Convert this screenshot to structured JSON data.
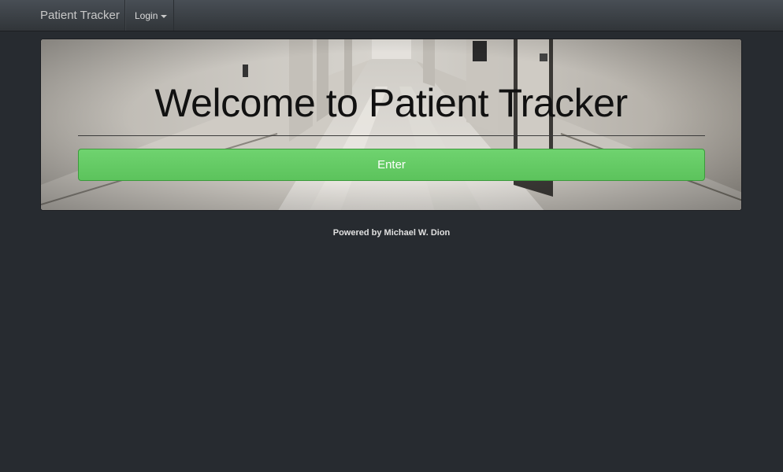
{
  "navbar": {
    "brand": "Patient Tracker",
    "login_label": "Login"
  },
  "hero": {
    "title": "Welcome to Patient Tracker",
    "enter_label": "Enter"
  },
  "footer": {
    "text": "Powered by Michael W. Dion"
  },
  "colors": {
    "page_bg": "#272b30",
    "navbar_bg": "#3a3f44",
    "enter_button": "#62c462"
  },
  "icons": {
    "login_caret": "caret-down-icon"
  }
}
